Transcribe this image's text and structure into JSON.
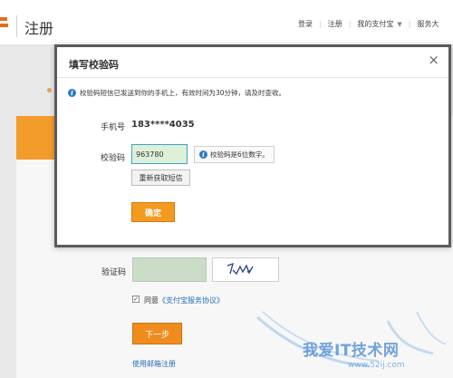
{
  "header": {
    "title": "注册",
    "nav": {
      "login": "登录",
      "register": "注册",
      "my_alipay": "我的支付宝",
      "more": "服务大"
    }
  },
  "form": {
    "captcha_label": "验证码",
    "agree_prefix": "同意",
    "agree_link": "《支付宝服务协议》",
    "next_label": "下一步",
    "email_register": "使用邮箱注册"
  },
  "dialog": {
    "title": "填写校验码",
    "close": "×",
    "notice": "校验码短信已发送到你的手机上，有效时间为30分钟，请及时查收。",
    "phone_label": "手机号",
    "phone_value": "183****4035",
    "code_label": "校验码",
    "code_value": "963780",
    "code_tip": "校验码是6位数字。",
    "resend_label": "重新获取短信",
    "confirm_label": "确定"
  },
  "watermark": {
    "text": "我爱IT技术网",
    "url": "www.52ij.com"
  },
  "colors": {
    "brand_orange": "#f39a20",
    "link_blue": "#2a6db3",
    "info_blue": "#2d7ac7"
  }
}
